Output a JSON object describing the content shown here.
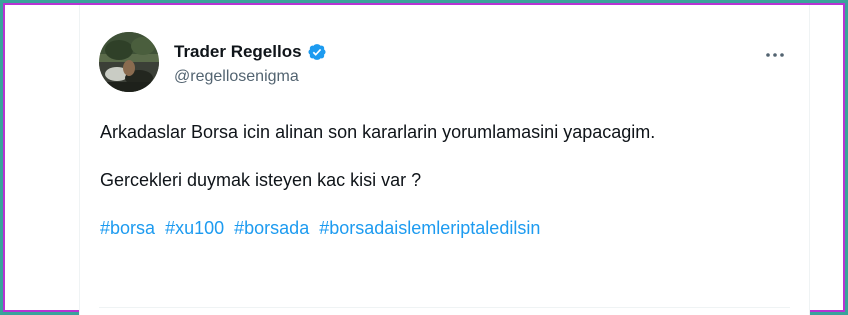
{
  "tweet": {
    "author": {
      "display_name": "Trader Regellos",
      "handle": "@regellosenigma",
      "verified": true,
      "avatar_icon": "profile-photo",
      "verified_icon": "verified-badge-icon"
    },
    "more_icon": "more-options-icon",
    "body_lines": [
      "Arkadaslar Borsa icin alinan son kararlarin yorumlamasini yapacagim.",
      "Gercekleri duymak isteyen kac kisi var ?"
    ],
    "hashtags": [
      "#borsa",
      "#xu100",
      "#borsada",
      "#borsadaislemleriptaledilsin"
    ]
  },
  "colors": {
    "frame_teal": "#3aa39b",
    "frame_purple": "#b733d3",
    "link_blue": "#1d9bf0",
    "verified_blue": "#1d9bf0",
    "text_primary": "#0f1419",
    "text_secondary": "#536471"
  }
}
